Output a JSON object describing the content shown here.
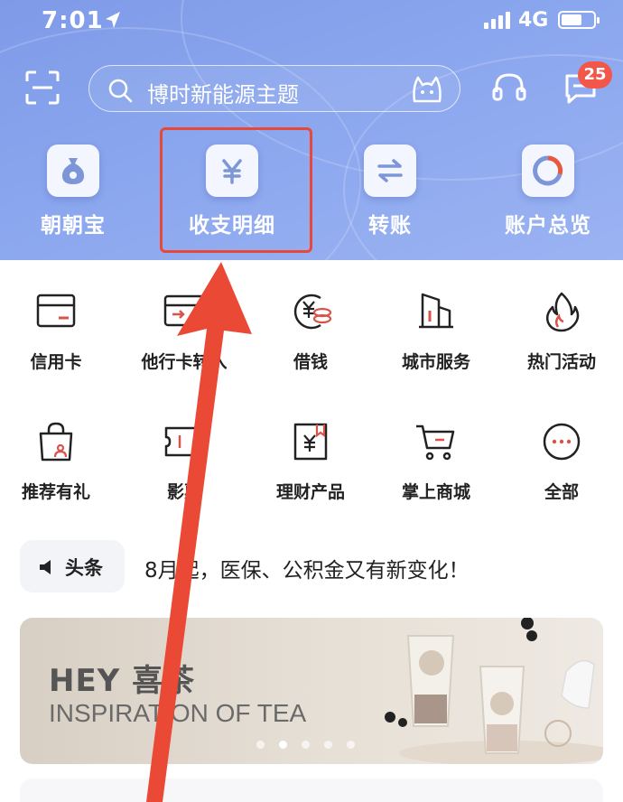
{
  "status_bar": {
    "time": "7:01",
    "network": "4G"
  },
  "search": {
    "placeholder": "博时新能源主题"
  },
  "notifications": {
    "badge_count": "25"
  },
  "quick_actions": [
    {
      "label": "朝朝宝",
      "icon": "money-bag-icon"
    },
    {
      "label": "收支明细",
      "icon": "yuan-icon"
    },
    {
      "label": "转账",
      "icon": "transfer-icon"
    },
    {
      "label": "账户总览",
      "icon": "ring-chart-icon"
    }
  ],
  "services": [
    {
      "label": "信用卡",
      "icon": "credit-card-icon"
    },
    {
      "label": "他行卡转入",
      "icon": "card-transfer-icon"
    },
    {
      "label": "借钱",
      "icon": "coin-icon"
    },
    {
      "label": "城市服务",
      "icon": "building-icon"
    },
    {
      "label": "热门活动",
      "icon": "flame-icon"
    },
    {
      "label": "推荐有礼",
      "icon": "gift-bag-icon"
    },
    {
      "label": "影票",
      "icon": "ticket-icon"
    },
    {
      "label": "理财产品",
      "icon": "finance-doc-icon"
    },
    {
      "label": "掌上商城",
      "icon": "cart-icon"
    },
    {
      "label": "全部",
      "icon": "more-icon"
    }
  ],
  "news": {
    "tag": "头条",
    "headline": "8月起，医保、公积金又有新变化！"
  },
  "banner": {
    "title": "HEY 喜茶",
    "subtitle": "INSPIRATION OF TEA",
    "active_slide": 2,
    "slide_count": 5
  },
  "colors": {
    "header_blue": "#8aa6ee",
    "accent_red": "#e8483a",
    "icon_red": "#d9534a"
  }
}
